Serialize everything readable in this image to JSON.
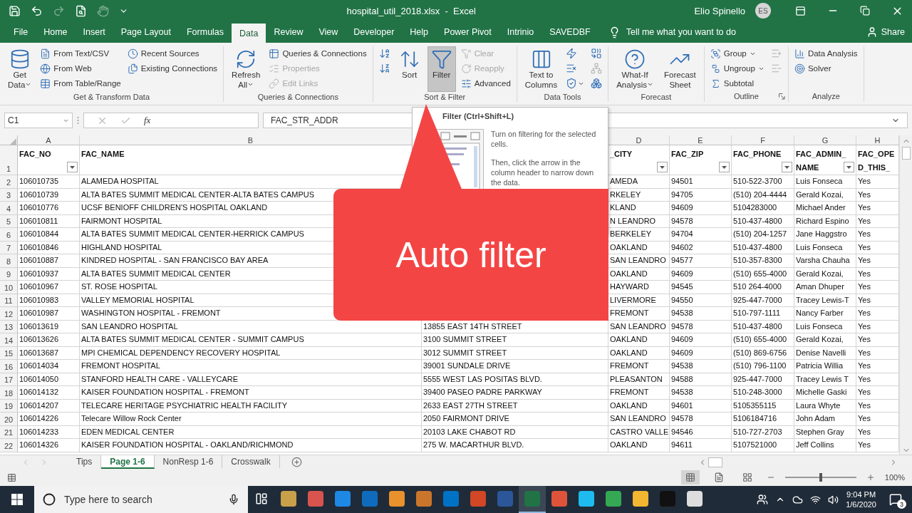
{
  "title_bar": {
    "title": "hospital_util_2018.xlsx  -  Excel",
    "user": "Elio Spinello",
    "avatar": "ES"
  },
  "quick_access": [
    {
      "disabled": false
    },
    {
      "disabled": false
    },
    {
      "disabled": true
    },
    {
      "disabled": false
    },
    {
      "disabled": true
    }
  ],
  "tabs": [
    {
      "label": "File",
      "selected": false
    },
    {
      "label": "Home",
      "selected": false
    },
    {
      "label": "Insert",
      "selected": false
    },
    {
      "label": "Page Layout",
      "selected": false
    },
    {
      "label": "Formulas",
      "selected": false
    },
    {
      "label": "Data",
      "selected": true
    },
    {
      "label": "Review",
      "selected": false
    },
    {
      "label": "View",
      "selected": false
    },
    {
      "label": "Developer",
      "selected": false
    },
    {
      "label": "Help",
      "selected": false
    },
    {
      "label": "Power Pivot",
      "selected": false
    },
    {
      "label": "Intrinio",
      "selected": false
    },
    {
      "label": "SAVEDBF",
      "selected": false
    }
  ],
  "tell_me": "Tell me what you want to do",
  "share": "Share",
  "ribbon": [
    {
      "label": "Get & Transform Data",
      "columns": [
        [
          {
            "kind": "large",
            "lines": [
              "Get",
              "Data"
            ],
            "dropdown": true,
            "disabled": false,
            "hovered": false
          }
        ],
        [
          {
            "kind": "small",
            "label": "From Text/CSV",
            "dropdown": false,
            "disabled": false,
            "hovered": false
          },
          {
            "kind": "small",
            "label": "From Web",
            "dropdown": false,
            "disabled": false,
            "hovered": false
          },
          {
            "kind": "small",
            "label": "From Table/Range",
            "dropdown": false,
            "disabled": false,
            "hovered": false
          }
        ],
        [
          {
            "kind": "small",
            "label": "Recent Sources",
            "dropdown": false,
            "disabled": false,
            "hovered": false
          },
          {
            "kind": "small",
            "label": "Existing Connections",
            "dropdown": false,
            "disabled": false,
            "hovered": false
          }
        ]
      ]
    },
    {
      "label": "Queries & Connections",
      "columns": [
        [
          {
            "kind": "large",
            "lines": [
              "Refresh",
              "All"
            ],
            "dropdown": true,
            "disabled": false,
            "hovered": false
          }
        ],
        [
          {
            "kind": "small",
            "label": "Queries & Connections",
            "dropdown": false,
            "disabled": false,
            "hovered": false
          },
          {
            "kind": "small",
            "label": "Properties",
            "dropdown": false,
            "disabled": true,
            "hovered": false
          },
          {
            "kind": "small",
            "label": "Edit Links",
            "dropdown": false,
            "disabled": true,
            "hovered": false
          }
        ]
      ]
    },
    {
      "label": "Sort & Filter",
      "columns": [
        [
          {
            "kind": "icon",
            "dropdown": false,
            "disabled": false,
            "hovered": false
          },
          {
            "kind": "icon",
            "dropdown": false,
            "disabled": false,
            "hovered": false
          }
        ],
        [
          {
            "kind": "large",
            "lines": [
              "Sort"
            ],
            "dropdown": false,
            "disabled": false,
            "hovered": false
          }
        ],
        [
          {
            "kind": "large",
            "lines": [
              "Filter"
            ],
            "dropdown": false,
            "disabled": false,
            "hovered": true
          }
        ],
        [
          {
            "kind": "small",
            "label": "Clear",
            "dropdown": false,
            "disabled": true,
            "hovered": false
          },
          {
            "kind": "small",
            "label": "Reapply",
            "dropdown": false,
            "disabled": true,
            "hovered": false
          },
          {
            "kind": "small",
            "label": "Advanced",
            "dropdown": false,
            "disabled": false,
            "hovered": false
          }
        ]
      ]
    },
    {
      "label": "Data Tools",
      "columns": [
        [
          {
            "kind": "large",
            "lines": [
              "Text to",
              "Columns"
            ],
            "dropdown": false,
            "disabled": false,
            "hovered": false
          }
        ],
        [
          {
            "kind": "icon",
            "dropdown": false,
            "disabled": false,
            "hovered": false
          },
          {
            "kind": "icon",
            "dropdown": false,
            "disabled": false,
            "hovered": false
          },
          {
            "kind": "icon",
            "dropdown": true,
            "disabled": false,
            "hovered": false
          }
        ],
        [
          {
            "kind": "icon",
            "dropdown": false,
            "disabled": false,
            "hovered": false
          },
          {
            "kind": "icon",
            "dropdown": false,
            "disabled": true,
            "hovered": false
          },
          {
            "kind": "icon",
            "dropdown": false,
            "disabled": false,
            "hovered": false
          }
        ]
      ]
    },
    {
      "label": "Forecast",
      "columns": [
        [
          {
            "kind": "large",
            "lines": [
              "What-If",
              "Analysis"
            ],
            "dropdown": true,
            "disabled": false,
            "hovered": false
          }
        ],
        [
          {
            "kind": "large",
            "lines": [
              "Forecast",
              "Sheet"
            ],
            "dropdown": false,
            "disabled": false,
            "hovered": false
          }
        ]
      ]
    },
    {
      "label": "Outline",
      "launcher": true,
      "columns": [
        [
          {
            "kind": "small",
            "label": "Group",
            "dropdown": true,
            "disabled": false,
            "hovered": false
          },
          {
            "kind": "small",
            "label": "Ungroup",
            "dropdown": true,
            "disabled": false,
            "hovered": false
          },
          {
            "kind": "small",
            "label": "Subtotal",
            "dropdown": false,
            "disabled": false,
            "hovered": false
          }
        ],
        [
          {
            "kind": "icon",
            "dropdown": false,
            "disabled": true,
            "hovered": false
          },
          {
            "kind": "icon",
            "dropdown": false,
            "disabled": true,
            "hovered": false
          }
        ]
      ]
    },
    {
      "label": "Analyze",
      "columns": [
        [
          {
            "kind": "small",
            "label": "Data Analysis",
            "dropdown": false,
            "disabled": false,
            "hovered": false
          },
          {
            "kind": "small",
            "label": "Solver",
            "dropdown": false,
            "disabled": false,
            "hovered": false
          }
        ]
      ]
    }
  ],
  "formula_bar": {
    "name_box": "C1",
    "function_label": "fx",
    "formula": "FAC_STR_ADDR"
  },
  "header_row_number": "1",
  "columns": [
    {
      "letter": "A",
      "header": [
        "FAC_NO"
      ],
      "filter_button": true
    },
    {
      "letter": "B",
      "header": [
        "FAC_NAME"
      ]
    },
    {},
    {
      "letter": "D",
      "header": [
        "_CITY"
      ],
      "filter_button": true
    },
    {
      "letter": "E",
      "header": [
        "FAC_ZIP"
      ],
      "filter_button": true
    },
    {
      "letter": "F",
      "header": [
        "FAC_PHONE"
      ],
      "filter_button": true
    },
    {
      "letter": "G",
      "header": [
        "FAC_ADMIN_",
        "NAME"
      ],
      "filter_button": true
    },
    {
      "letter": "H",
      "header": [
        "FAC_OPE",
        "D_THIS_"
      ],
      "filter_button": false
    }
  ],
  "rows": [
    {
      "number": "2",
      "cells": [
        "106010735",
        "ALAMEDA HOSPITAL",
        null,
        "AMEDA",
        "94501",
        "510-522-3700",
        "Luis Fonseca",
        "Yes"
      ]
    },
    {
      "number": "3",
      "cells": [
        "106010739",
        "ALTA BATES SUMMIT MEDICAL CENTER-ALTA BATES CAMPUS",
        null,
        "RKELEY",
        "94705",
        "(510) 204-4444",
        "Gerald Kozai,",
        "Yes"
      ]
    },
    {
      "number": "4",
      "cells": [
        "106010776",
        "UCSF BENIOFF CHILDREN'S HOSPITAL OAKLAND",
        null,
        "KLAND",
        "94609",
        "5104283000",
        "Michael Ander",
        "Yes"
      ]
    },
    {
      "number": "5",
      "cells": [
        "106010811",
        "FAIRMONT HOSPITAL",
        null,
        "N LEANDRO",
        "94578",
        "510-437-4800",
        "Richard Espino",
        "Yes"
      ]
    },
    {
      "number": "6",
      "cells": [
        "106010844",
        "ALTA BATES SUMMIT MEDICAL CENTER-HERRICK CAMPUS",
        null,
        "BERKELEY",
        "94704",
        "(510) 204-1257",
        "Jane Haggstro",
        "Yes"
      ]
    },
    {
      "number": "7",
      "cells": [
        "106010846",
        "HIGHLAND HOSPITAL",
        null,
        "OAKLAND",
        "94602",
        "510-437-4800",
        "Luis Fonseca",
        "Yes"
      ]
    },
    {
      "number": "8",
      "cells": [
        "106010887",
        "KINDRED HOSPITAL - SAN FRANCISCO BAY AREA",
        null,
        "SAN LEANDRO",
        "94577",
        "510-357-8300",
        "Varsha Chauha",
        "Yes"
      ]
    },
    {
      "number": "9",
      "cells": [
        "106010937",
        "ALTA BATES SUMMIT MEDICAL CENTER",
        null,
        "OAKLAND",
        "94609",
        "(510) 655-4000",
        "Gerald Kozai,",
        "Yes"
      ]
    },
    {
      "number": "10",
      "cells": [
        "106010967",
        "ST. ROSE HOSPITAL",
        null,
        "HAYWARD",
        "94545",
        "510 264-4000",
        "Aman Dhuper",
        "Yes"
      ]
    },
    {
      "number": "11",
      "cells": [
        "106010983",
        "VALLEY MEMORIAL HOSPITAL",
        null,
        "LIVERMORE",
        "94550",
        "925-447-7000",
        "Tracey Lewis-T",
        "Yes"
      ]
    },
    {
      "number": "12",
      "cells": [
        "106010987",
        "WASHINGTON HOSPITAL - FREMONT",
        null,
        "FREMONT",
        "94538",
        "510-797-1111",
        "Nancy Farber",
        "Yes"
      ]
    },
    {
      "number": "13",
      "cells": [
        "106013619",
        "SAN LEANDRO HOSPITAL",
        "13855 EAST 14TH STREET",
        "SAN LEANDRO",
        "94578",
        "510-437-4800",
        "Luis Fonseca",
        "Yes"
      ]
    },
    {
      "number": "14",
      "cells": [
        "106013626",
        "ALTA BATES SUMMIT MEDICAL CENTER - SUMMIT CAMPUS",
        "3100 SUMMIT STREET",
        "OAKLAND",
        "94609",
        "(510) 655-4000",
        "Gerald Kozai,",
        "Yes"
      ]
    },
    {
      "number": "15",
      "cells": [
        "106013687",
        "MPI CHEMICAL DEPENDENCY RECOVERY HOSPITAL",
        "3012 SUMMIT STREET",
        "OAKLAND",
        "94609",
        "(510) 869-6756",
        "Denise Navelli",
        "Yes"
      ]
    },
    {
      "number": "16",
      "cells": [
        "106014034",
        "FREMONT HOSPITAL",
        "39001 SUNDALE DRIVE",
        "FREMONT",
        "94538",
        "(510) 796-1100",
        "Patricia Willia",
        "Yes"
      ]
    },
    {
      "number": "17",
      "cells": [
        "106014050",
        "STANFORD HEALTH CARE - VALLEYCARE",
        "5555 WEST LAS POSITAS BLVD.",
        "PLEASANTON",
        "94588",
        "925-447-7000",
        "Tracey Lewis T",
        "Yes"
      ]
    },
    {
      "number": "18",
      "cells": [
        "106014132",
        "KAISER FOUNDATION HOSPITAL - FREMONT",
        "39400 PASEO PADRE PARKWAY",
        "FREMONT",
        "94538",
        "510-248-3000",
        "Michelle Gaski",
        "Yes"
      ]
    },
    {
      "number": "19",
      "cells": [
        "106014207",
        "TELECARE HERITAGE PSYCHIATRIC HEALTH FACILITY",
        "2633 EAST 27TH STREET",
        "OAKLAND",
        "94601",
        "5105355115",
        "Laura Whyte",
        "Yes"
      ]
    },
    {
      "number": "20",
      "cells": [
        "106014226",
        "Telecare Willow Rock Center",
        "2050 FAIRMONT DRIVE",
        "SAN LEANDRO",
        "94578",
        "5106184716",
        "John Adam",
        "Yes"
      ]
    },
    {
      "number": "21",
      "cells": [
        "106014233",
        "EDEN MEDICAL CENTER",
        "20103 LAKE CHABOT RD",
        "CASTRO VALLE",
        "94546",
        "510-727-2703",
        "Stephen Gray",
        "Yes"
      ]
    },
    {
      "number": "22",
      "cells": [
        "106014326",
        "KAISER FOUNDATION HOSPITAL - OAKLAND/RICHMOND",
        "275 W. MACARTHUR BLVD.",
        "OAKLAND",
        "94611",
        "5107521000",
        "Jeff Collins",
        "Yes"
      ]
    }
  ],
  "sheet_tabs": [
    {
      "label": "Tips",
      "selected": false
    },
    {
      "label": "Page 1-6",
      "selected": true
    },
    {
      "label": "NonResp 1-6",
      "selected": false
    },
    {
      "label": "Crosswalk",
      "selected": false
    }
  ],
  "status_bar": {
    "views": [
      {
        "selected": true
      },
      {
        "selected": false
      },
      {
        "selected": false
      }
    ],
    "zoom": {
      "level": 0.5,
      "label": "100%"
    }
  },
  "taskbar": {
    "search_placeholder": "Type here to search",
    "apps": [
      {
        "color": "#c8a04a",
        "selected": false
      },
      {
        "color": "#d9534f",
        "selected": false
      },
      {
        "color": "#1e88e5",
        "selected": false
      },
      {
        "color": "#0f6cbd",
        "selected": false
      },
      {
        "color": "#e8912d",
        "selected": false
      },
      {
        "color": "#c9762c",
        "selected": false
      },
      {
        "color": "#0072c6",
        "selected": false
      },
      {
        "color": "#d24726",
        "selected": false
      },
      {
        "color": "#2b579a",
        "selected": false
      },
      {
        "color": "#217346",
        "selected": true
      },
      {
        "color": "#e0533b",
        "selected": false
      },
      {
        "color": "#1ebbee",
        "selected": false
      },
      {
        "color": "#34a853",
        "selected": false
      },
      {
        "color": "#f2b632",
        "selected": false
      },
      {
        "color": "#111111",
        "selected": false
      },
      {
        "color": "#dddddd",
        "selected": false
      }
    ],
    "time": "9:04 PM",
    "date": "1/6/2020",
    "notifications": "3"
  },
  "tooltip": {
    "title": "Filter (Ctrl+Shift+L)",
    "paragraphs": [
      "Turn on filtering for the selected cells.",
      "Then, click the arrow in the column header to narrow down the data."
    ]
  },
  "callout": {
    "text": "Auto filter"
  }
}
